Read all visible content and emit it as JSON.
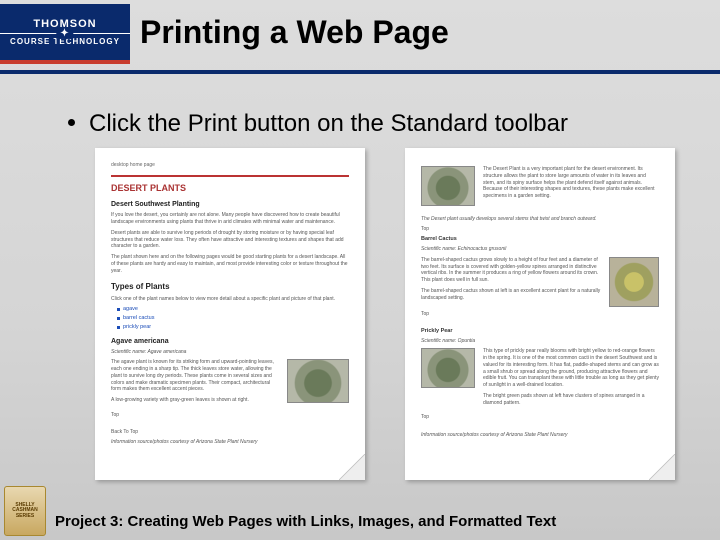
{
  "brand": {
    "top": "THOMSON",
    "bottom": "COURSE TECHNOLOGY"
  },
  "title": "Printing a Web Page",
  "bullet": "Click the Print button on the Standard toolbar",
  "footer": "Project 3: Creating Web Pages with Links, Images, and Formatted Text",
  "badge": {
    "l1": "SHELLY",
    "l2": "CASHMAN",
    "l3": "SERIES"
  },
  "page1": {
    "header": "desktop home page",
    "h1": "DESERT PLANTS",
    "h2": "Desert Southwest Planting",
    "para1": "If you love the desert, you certainly are not alone. Many people have discovered how to create beautiful landscape environments using plants that thrive in arid climates with minimal water and maintenance.",
    "para2": "Desert plants are able to survive long periods of drought by storing moisture or by having special leaf structures that reduce water loss. They often have attractive and interesting textures and shapes that add character to a garden.",
    "para3": "The plant shown here and on the following pages would be good starting plants for a desert landscape. All of these plants are hardy and easy to maintain, and most provide interesting color or texture throughout the year.",
    "h3": "Types of Plants",
    "intro": "Click one of the plant names below to view more detail about a specific plant and picture of that plant.",
    "links": [
      "agave",
      "barrel cactus",
      "prickly pear"
    ],
    "h4": "Agave americana",
    "sci": "Scientific name: Agave americana",
    "desc": "The agave plant is known for its striking form and upward-pointing leaves, each one ending in a sharp tip. The thick leaves store water, allowing the plant to survive long dry periods. These plants come in several sizes and colors and make dramatic specimen plants. Their compact, architectural form makes them excellent accent pieces.",
    "tail1": "A low-growing variety with gray-green leaves is shown at right.",
    "topLabel": "Top",
    "backLabel": "Back To Top",
    "credit": "Information source/photos courtesy of Arizona State Plant Nursery"
  },
  "page2": {
    "topDesc": "The Desert Plant is a very important plant for the desert environment. Its structure allows the plant to store large amounts of water in its leaves and stem, and its spiny surface helps the plant defend itself against animals. Because of their interesting shapes and textures, these plants make excellent specimens in a garden setting.",
    "note": "The Desert plant usually develops several stems that twist and branch outward.",
    "topLabel": "Top",
    "h_bc": "Barrel Cactus",
    "sci_bc": "Scientific name: Echinocactus grusonii",
    "desc_bc": "The barrel-shaped cactus grows slowly to a height of four feet and a diameter of two feet. Its surface is covered with golden-yellow spines arranged in distinctive vertical ribs. In the summer it produces a ring of yellow flowers around its crown. This plant does well in full sun.",
    "tail_bc": "The barrel-shaped cactus shown at left is an excellent accent plant for a naturally landscaped setting.",
    "h_pp": "Prickly Pear",
    "sci_pp": "Scientific name: Opuntia",
    "desc_pp": "This type of prickly pear really blooms with bright yellow to red-orange flowers in the spring. It is one of the most common cacti in the desert Southwest and is valued for its interesting form. It has flat, paddle-shaped stems and can grow as a small shrub or spread along the ground, producing attractive flowers and edible fruit. You can transplant these with little trouble as long as they get plenty of sunlight in a well-drained location.",
    "tail_pp": "The bright green pads shown at left have clusters of spines arranged in a diamond pattern.",
    "backLabel": "Top",
    "credit": "Information source/photos courtesy of Arizona State Plant Nursery"
  }
}
